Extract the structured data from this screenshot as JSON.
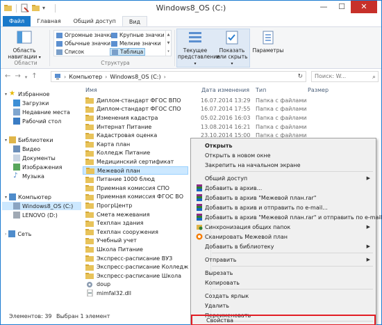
{
  "window": {
    "title": "Windows8_OS (C:)",
    "accent": "#1979ca"
  },
  "tabs": [
    "Файл",
    "Главная",
    "Общий доступ",
    "Вид"
  ],
  "ribbon": {
    "nav_pane_label": "Область навигации",
    "group_areas": "Области",
    "layout": {
      "huge_icons": "Огромные значки",
      "large_icons": "Крупные значки",
      "normal_icons": "Обычные значки",
      "small_icons": "Мелкие значки",
      "list": "Список",
      "table": "Таблица"
    },
    "group_structure": "Структура",
    "current_view": "Текущее представление",
    "show_hide": "Показать или скрыть",
    "options": "Параметры"
  },
  "address": {
    "computer": "Компьютер",
    "drive": "Windows8_OS (C:)",
    "search_placeholder": "Поиск: W..."
  },
  "navpane": {
    "favorites": "Избранное",
    "downloads": "Загрузки",
    "recent": "Недавние места",
    "desktop": "Рабочий стол",
    "libraries": "Библиотеки",
    "video": "Видео",
    "documents": "Документы",
    "images": "Изображения",
    "music": "Музыка",
    "computer": "Компьютер",
    "drive_c": "Windows8_OS (C:)",
    "drive_d": "LENOVO (D:)",
    "network": "Сеть"
  },
  "columns": {
    "name": "Имя",
    "date": "Дата изменения",
    "type": "Тип",
    "size": "Размер"
  },
  "files": [
    {
      "name": "Диплом-стандарт ФГОС ВПО",
      "date": "16.07.2014 13:29",
      "type": "Папка с файлами"
    },
    {
      "name": "Диплом-стандарт ФГОС СПО",
      "date": "16.07.2014 17:55",
      "type": "Папка с файлами"
    },
    {
      "name": "Изменения кадастра",
      "date": "05.02.2016 16:03",
      "type": "Папка с файлами"
    },
    {
      "name": "Интернат Питание",
      "date": "13.08.2014 16:21",
      "type": "Папка с файлами"
    },
    {
      "name": "Кадастровая оценка",
      "date": "23.10.2014 15:00",
      "type": "Папка с файлами"
    },
    {
      "name": "Карта план",
      "date": "",
      "type": ""
    },
    {
      "name": "Колледж Питание",
      "date": "",
      "type": ""
    },
    {
      "name": "Медицинский сертификат",
      "date": "",
      "type": ""
    },
    {
      "name": "Межевой план",
      "date": "",
      "type": ""
    },
    {
      "name": "Питание 1000 блюд",
      "date": "",
      "type": ""
    },
    {
      "name": "Приемная комиссия СПО",
      "date": "",
      "type": ""
    },
    {
      "name": "Приемная комиссия ФГОС ВО",
      "date": "",
      "type": ""
    },
    {
      "name": "ПрогрЦентр",
      "date": "",
      "type": ""
    },
    {
      "name": "Смета межевания",
      "date": "",
      "type": ""
    },
    {
      "name": "Техплан здания",
      "date": "",
      "type": ""
    },
    {
      "name": "Техплан сооружения",
      "date": "",
      "type": ""
    },
    {
      "name": "Учебный учет",
      "date": "",
      "type": ""
    },
    {
      "name": "Школа Питание",
      "date": "",
      "type": ""
    },
    {
      "name": "Экспресс-расписание ВУЗ",
      "date": "",
      "type": ""
    },
    {
      "name": "Экспресс-расписание Колледж",
      "date": "",
      "type": ""
    },
    {
      "name": "Экспресс-расписание Школа",
      "date": "",
      "type": ""
    },
    {
      "name": "doup",
      "date": "",
      "type": ""
    },
    {
      "name": "mimfal32.dll",
      "date": "",
      "type": ""
    }
  ],
  "status": {
    "items": "Элементов: 39",
    "selected": "Выбран 1 элемент"
  },
  "context_menu": {
    "open": "Открыть",
    "open_new_window": "Открыть в новом окне",
    "pin_start": "Закрепить на начальном экране",
    "share": "Общий доступ",
    "add_archive": "Добавить в архив...",
    "add_rar": "Добавить в архив \"Межевой план.rar\"",
    "add_email": "Добавить в архив и отправить по e-mail...",
    "add_rar_email": "Добавить в архив \"Межевой план.rar\" и отправить по e-mail",
    "sync": "Синхронизация общих папок",
    "scan": "Сканировать Межевой план",
    "library": "Добавить в библиотеку",
    "send_to": "Отправить",
    "cut": "Вырезать",
    "copy": "Копировать",
    "shortcut": "Создать ярлык",
    "delete": "Удалить",
    "rename": "Переименовать",
    "properties": "Свойства"
  }
}
